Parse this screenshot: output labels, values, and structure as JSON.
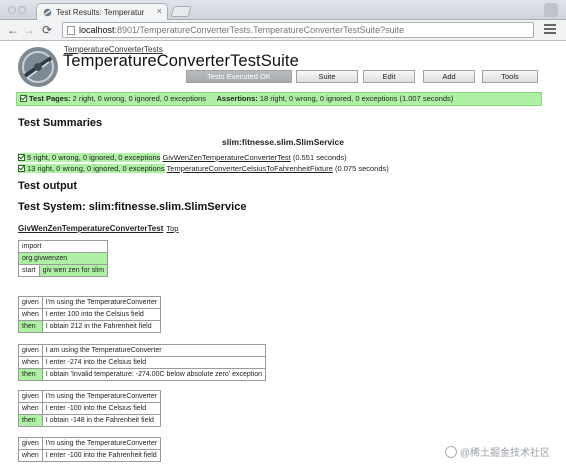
{
  "browser": {
    "tab_title": "Test Results: Temperatur",
    "tab_close": "×",
    "url_host": "localhost",
    "url_rest": ":8901/TemperatureConverterTests.TemperatureConverterTestSuite?suite",
    "back": "←",
    "forward": "→",
    "reload": "⟳"
  },
  "header": {
    "breadcrumb": "TemperatureConverterTests",
    "title": "TemperatureConverterTestSuite",
    "buttons": [
      "Tests Executed OK",
      "Suite",
      "Edit",
      "Add",
      "Tools"
    ]
  },
  "summary": {
    "pages_label": "Test Pages:",
    "pages_text": "2 right, 0 wrong, 0 ignored, 0 exceptions",
    "assertions_label": "Assertions:",
    "assertions_text": "18 right, 0 wrong, 0 ignored, 0 exceptions (1.007 seconds)"
  },
  "test_summaries": {
    "heading": "Test Summaries",
    "service": "slim:fitnesse.slim.SlimService",
    "rows": [
      {
        "result": "5 right, 0 wrong, 0 ignored, 0 exceptions",
        "link": "GivWenZenTemperatureConverterTest",
        "time": "(0.551 seconds)"
      },
      {
        "result": "13 right, 0 wrong, 0 ignored, 0 exceptions",
        "link": "TemperatureConverterCelsiusToFahrenheitFixture",
        "time": "(0.075 seconds)"
      }
    ]
  },
  "output": {
    "heading": "Test output",
    "system_heading": "Test System: slim:fitnesse.slim.SlimService",
    "fixture_link": "GivWenZenTemperatureConverterTest",
    "top_link": "Top"
  },
  "import_table": {
    "rows": [
      [
        "import"
      ],
      [
        "org.givwenzen"
      ],
      [
        "start",
        "giv wen zen for slim"
      ]
    ]
  },
  "scenario_tables": [
    [
      [
        "given",
        "I'm using the TemperatureConverter"
      ],
      [
        "when",
        "I enter 100 into the Celsius field"
      ],
      [
        "then",
        "I obtain 212 in the Fahrenheit field"
      ]
    ],
    [
      [
        "given",
        "I am using the TemperatureConverter"
      ],
      [
        "when",
        "I enter -274 into the Celsius field"
      ],
      [
        "then",
        "I obtain 'Invalid temperature: -274.00C below absolute zero' exception"
      ]
    ],
    [
      [
        "given",
        "I'm using the TemperatureConverter"
      ],
      [
        "when",
        "I enter -100 into the Celsius field"
      ],
      [
        "then",
        "I obtain -148 in the Fahrenheit field"
      ]
    ],
    [
      [
        "given",
        "I'm using the TemperatureConverter"
      ],
      [
        "when",
        "I enter -100 into the Fahrenheit field"
      ]
    ]
  ],
  "watermark": "@稀土掘金技术社区",
  "colors": {
    "pass_green": "#aef0a4"
  }
}
